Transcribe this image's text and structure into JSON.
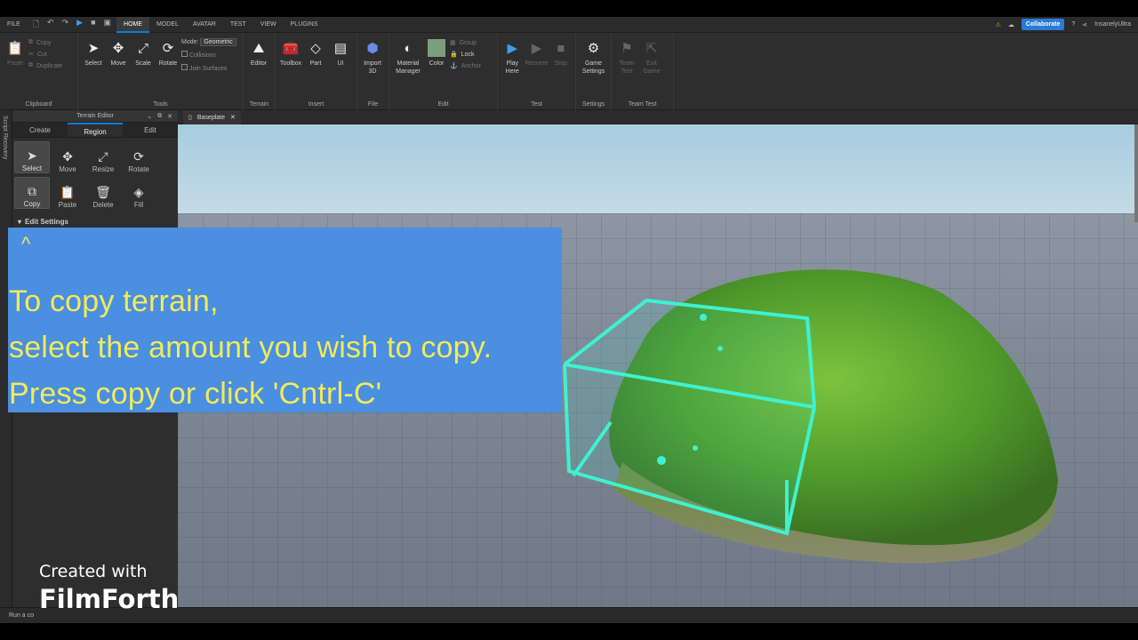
{
  "menubar": {
    "file": "FILE",
    "tabs": [
      "HOME",
      "MODEL",
      "AVATAR",
      "TEST",
      "VIEW",
      "PLUGINS"
    ],
    "collaborate": "Collaborate",
    "user": "InsanelyUltra"
  },
  "ribbon": {
    "clipboard": {
      "label": "Clipboard",
      "paste": "Paste",
      "copy": "Copy",
      "cut": "Cut",
      "duplicate": "Duplicate"
    },
    "tools": {
      "label": "Tools",
      "select": "Select",
      "move": "Move",
      "scale": "Scale",
      "rotate": "Rotate",
      "mode_label": "Mode:",
      "mode_value": "Geometric",
      "collisions": "Collisions",
      "join_surfaces": "Join Surfaces"
    },
    "terrain": {
      "label": "Terrain",
      "editor": "Editor"
    },
    "insert": {
      "label": "Insert",
      "toolbox": "Toolbox",
      "part": "Part",
      "ui": "UI"
    },
    "file": {
      "label": "File",
      "import3d_1": "Import",
      "import3d_2": "3D"
    },
    "edit": {
      "label": "Edit",
      "material_1": "Material",
      "material_2": "Manager",
      "color": "Color",
      "group": "Group",
      "lock": "Lock",
      "anchor": "Anchor"
    },
    "test": {
      "label": "Test",
      "play_1": "Play",
      "play_2": "Here",
      "resume": "Resume",
      "stop": "Stop"
    },
    "settings": {
      "label": "Settings",
      "game_1": "Game",
      "game_2": "Settings"
    },
    "team_test": {
      "label": "Team Test",
      "team_1": "Team",
      "team_2": "Test",
      "exit_1": "Exit",
      "exit_2": "Game"
    }
  },
  "left_strip": "Script Recovery",
  "terrain_editor": {
    "title": "Terrain Editor",
    "tabs": [
      "Create",
      "Region",
      "Edit"
    ],
    "tools": [
      "Select",
      "Move",
      "Resize",
      "Rotate",
      "Copy",
      "Paste",
      "Delete",
      "Fill"
    ],
    "edit_settings": "Edit Settings"
  },
  "doc_tab": "Baseplate",
  "status": "Run a co",
  "caption": {
    "caret": "^",
    "line1": "To copy terrain,",
    "line2": "select the amount you wish to copy.",
    "line3": "Press copy or click 'Cntrl-C'"
  },
  "watermark": {
    "line1": "Created with",
    "line2": "FilmForth"
  },
  "colors": {
    "accent": "#0b7fd6",
    "collaborate": "#2a7bd4",
    "overlay": "#4a8fe0",
    "caption": "#f2ea5a",
    "selection_box": "#3df2d0"
  }
}
